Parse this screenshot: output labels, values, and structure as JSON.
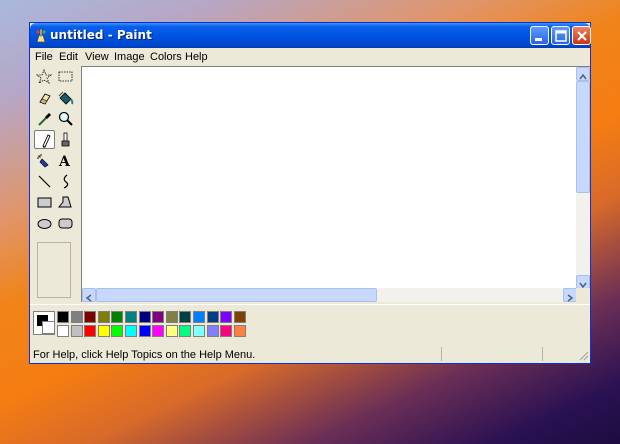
{
  "window": {
    "title": "untitled - Paint",
    "title_bar_color": "#0054e3"
  },
  "title_buttons": {
    "minimize": "minimize-icon",
    "maximize": "maximize-icon",
    "close": "close-icon"
  },
  "menu": [
    "File",
    "Edit",
    "View",
    "Image",
    "Colors",
    "Help"
  ],
  "tools": [
    {
      "name": "free-form-select",
      "icon": "star-select-icon"
    },
    {
      "name": "select",
      "icon": "rect-select-icon"
    },
    {
      "name": "eraser",
      "icon": "eraser-icon"
    },
    {
      "name": "fill-with-color",
      "icon": "paint-bucket-icon"
    },
    {
      "name": "pick-color",
      "icon": "eyedropper-icon"
    },
    {
      "name": "magnifier",
      "icon": "magnifier-icon"
    },
    {
      "name": "pencil",
      "icon": "pencil-icon",
      "selected": true
    },
    {
      "name": "brush",
      "icon": "brush-icon"
    },
    {
      "name": "airbrush",
      "icon": "airbrush-icon"
    },
    {
      "name": "text",
      "icon": "text-icon",
      "glyph": "A"
    },
    {
      "name": "line",
      "icon": "line-icon"
    },
    {
      "name": "curve",
      "icon": "curve-icon"
    },
    {
      "name": "rectangle",
      "icon": "rectangle-icon"
    },
    {
      "name": "polygon",
      "icon": "polygon-icon"
    },
    {
      "name": "ellipse",
      "icon": "ellipse-icon"
    },
    {
      "name": "rounded-rectangle",
      "icon": "rounded-rect-icon"
    }
  ],
  "current_colors": {
    "foreground": "#000000",
    "background": "#ffffff"
  },
  "palette": {
    "row1": [
      "#000000",
      "#808080",
      "#800000",
      "#808000",
      "#008000",
      "#008080",
      "#000080",
      "#800080",
      "#808040",
      "#004040",
      "#0080ff",
      "#004080",
      "#8000ff",
      "#804000"
    ],
    "row2": [
      "#ffffff",
      "#c0c0c0",
      "#ff0000",
      "#ffff00",
      "#00ff00",
      "#00ffff",
      "#0000ff",
      "#ff00ff",
      "#ffff80",
      "#00ff80",
      "#80ffff",
      "#8080ff",
      "#ff0080",
      "#ff8040"
    ]
  },
  "status": {
    "help_text": "For Help, click Help Topics on the Help Menu."
  }
}
